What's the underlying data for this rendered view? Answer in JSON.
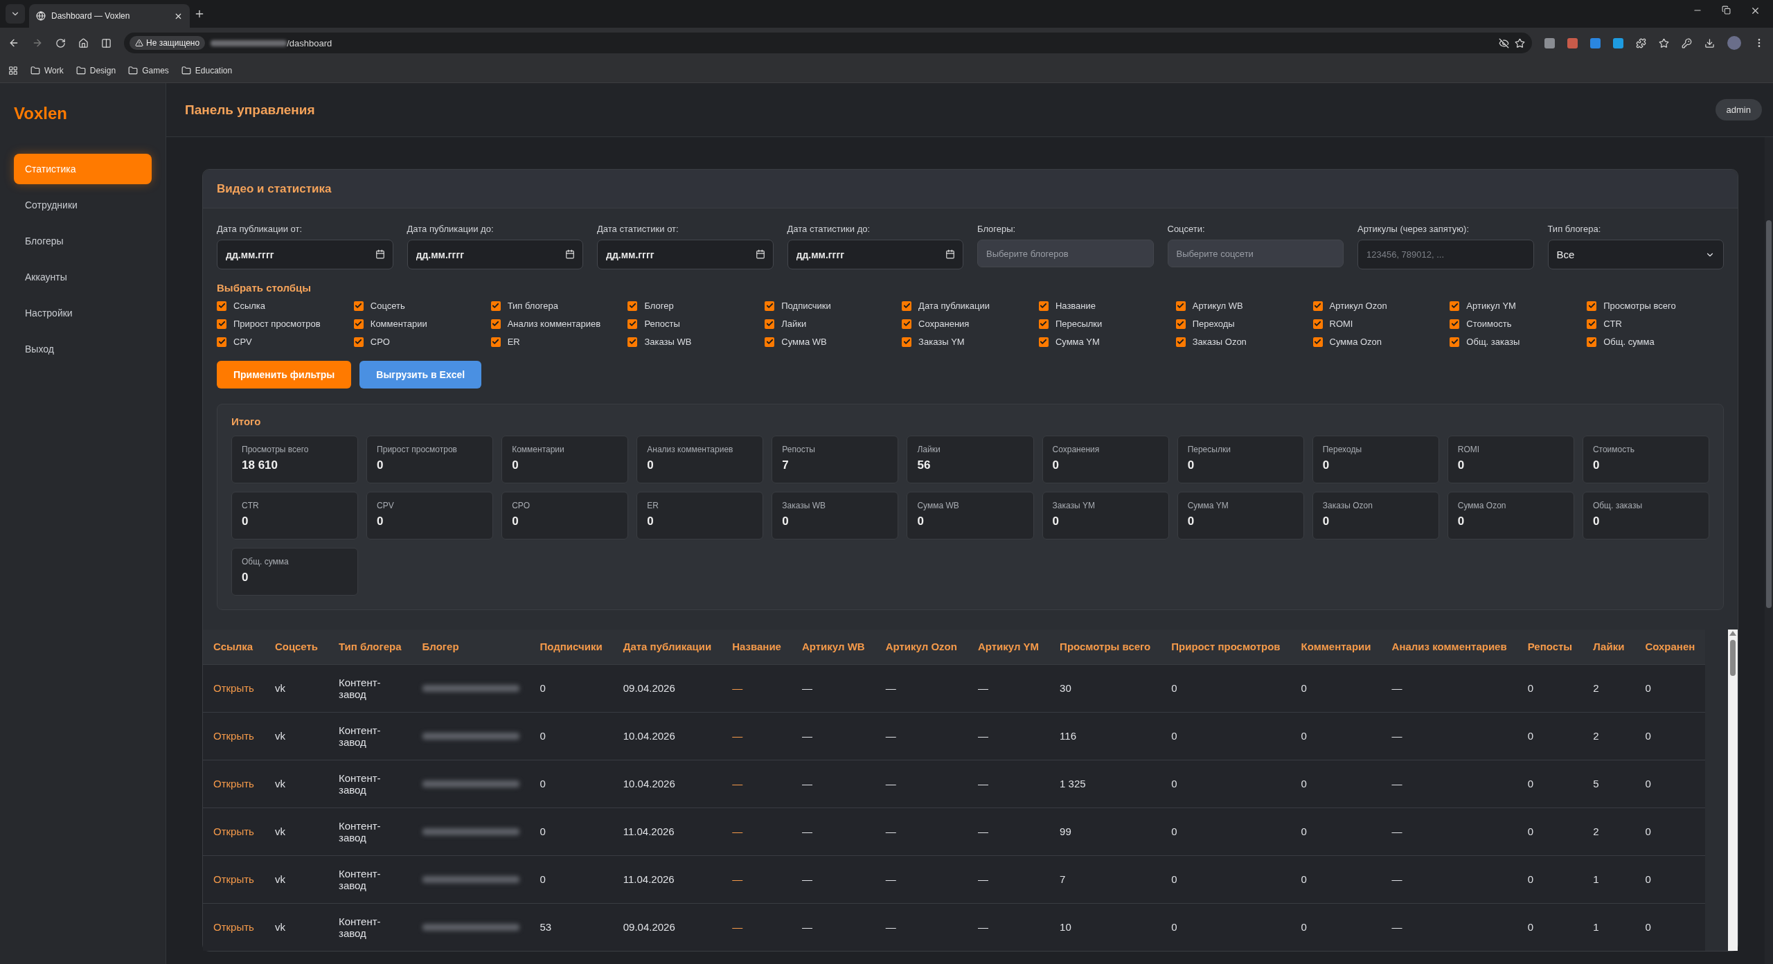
{
  "browser": {
    "tab_title": "Dashboard — Voxlen",
    "security_label": "Не защищено",
    "url_path": "/dashboard",
    "bookmarks": [
      "Work",
      "Design",
      "Games",
      "Education"
    ]
  },
  "sidebar": {
    "logo": "Voxlen",
    "items": [
      {
        "label": "Статистика",
        "selected": true
      },
      {
        "label": "Сотрудники",
        "selected": false
      },
      {
        "label": "Блогеры",
        "selected": false
      },
      {
        "label": "Аккаунты",
        "selected": false
      },
      {
        "label": "Настройки",
        "selected": false
      },
      {
        "label": "Выход",
        "selected": false
      }
    ]
  },
  "header": {
    "title": "Панель управления",
    "user": "admin"
  },
  "panel": {
    "title": "Видео и статистика",
    "filters": [
      {
        "label": "Дата публикации от:",
        "kind": "date",
        "placeholder": "дд.мм.гггг"
      },
      {
        "label": "Дата публикации до:",
        "kind": "date",
        "placeholder": "дд.мм.гггг"
      },
      {
        "label": "Дата статистики от:",
        "kind": "date",
        "placeholder": "дд.мм.гггг"
      },
      {
        "label": "Дата статистики до:",
        "kind": "date",
        "placeholder": "дд.мм.гггг"
      },
      {
        "label": "Блогеры:",
        "kind": "multi",
        "placeholder": "Выберите блогеров"
      },
      {
        "label": "Соцсети:",
        "kind": "multi",
        "placeholder": "Выберите соцсети"
      },
      {
        "label": "Артикулы (через запятую):",
        "kind": "text",
        "placeholder": "123456, 789012, ..."
      },
      {
        "label": "Тип блогера:",
        "kind": "select",
        "value": "Все"
      }
    ],
    "columns_title": "Выбрать столбцы",
    "columns": [
      {
        "label": "Ссылка",
        "checked": true
      },
      {
        "label": "Соцсеть",
        "checked": true
      },
      {
        "label": "Тип блогера",
        "checked": true
      },
      {
        "label": "Блогер",
        "checked": true
      },
      {
        "label": "Подписчики",
        "checked": true
      },
      {
        "label": "Дата публикации",
        "checked": true
      },
      {
        "label": "Название",
        "checked": true
      },
      {
        "label": "Артикул WB",
        "checked": true
      },
      {
        "label": "Артикул Ozon",
        "checked": true
      },
      {
        "label": "Артикул YM",
        "checked": true
      },
      {
        "label": "Просмотры всего",
        "checked": true
      },
      {
        "label": "Прирост просмотров",
        "checked": true
      },
      {
        "label": "Комментарии",
        "checked": true
      },
      {
        "label": "Анализ комментариев",
        "checked": true
      },
      {
        "label": "Репосты",
        "checked": true
      },
      {
        "label": "Лайки",
        "checked": true
      },
      {
        "label": "Сохранения",
        "checked": true
      },
      {
        "label": "Пересылки",
        "checked": true
      },
      {
        "label": "Переходы",
        "checked": true
      },
      {
        "label": "ROMI",
        "checked": true
      },
      {
        "label": "Стоимость",
        "checked": true
      },
      {
        "label": "CTR",
        "checked": true
      },
      {
        "label": "CPV",
        "checked": true
      },
      {
        "label": "CPO",
        "checked": true
      },
      {
        "label": "ER",
        "checked": true
      },
      {
        "label": "Заказы WB",
        "checked": true
      },
      {
        "label": "Сумма WB",
        "checked": true
      },
      {
        "label": "Заказы YM",
        "checked": true
      },
      {
        "label": "Сумма YM",
        "checked": true
      },
      {
        "label": "Заказы Ozon",
        "checked": true
      },
      {
        "label": "Сумма Ozon",
        "checked": true
      },
      {
        "label": "Общ. заказы",
        "checked": true
      },
      {
        "label": "Общ. сумма",
        "checked": true
      }
    ],
    "buttons": [
      {
        "label": "Применить фильтры",
        "kind": "primary"
      },
      {
        "label": "Выгрузить в Excel",
        "kind": "secondary"
      }
    ],
    "totals": {
      "title": "Итого",
      "items": [
        {
          "label": "Просмотры всего",
          "value": "18 610"
        },
        {
          "label": "Прирост просмотров",
          "value": "0"
        },
        {
          "label": "Комментарии",
          "value": "0"
        },
        {
          "label": "Анализ комментариев",
          "value": "0"
        },
        {
          "label": "Репосты",
          "value": "7"
        },
        {
          "label": "Лайки",
          "value": "56"
        },
        {
          "label": "Сохранения",
          "value": "0"
        },
        {
          "label": "Пересылки",
          "value": "0"
        },
        {
          "label": "Переходы",
          "value": "0"
        },
        {
          "label": "ROMI",
          "value": "0"
        },
        {
          "label": "Стоимость",
          "value": "0"
        },
        {
          "label": "CTR",
          "value": "0"
        },
        {
          "label": "CPV",
          "value": "0"
        },
        {
          "label": "CPO",
          "value": "0"
        },
        {
          "label": "ER",
          "value": "0"
        },
        {
          "label": "Заказы WB",
          "value": "0"
        },
        {
          "label": "Сумма WB",
          "value": "0"
        },
        {
          "label": "Заказы YM",
          "value": "0"
        },
        {
          "label": "Сумма YM",
          "value": "0"
        },
        {
          "label": "Заказы Ozon",
          "value": "0"
        },
        {
          "label": "Сумма Ozon",
          "value": "0"
        },
        {
          "label": "Общ. заказы",
          "value": "0"
        },
        {
          "label": "Общ. сумма",
          "value": "0"
        }
      ]
    }
  },
  "table": {
    "columns": [
      {
        "label": "Ссылка",
        "kind": "link"
      },
      {
        "label": "Соцсеть",
        "kind": "text"
      },
      {
        "label": "Тип блогера",
        "kind": "wrap"
      },
      {
        "label": "Блогер",
        "kind": "redacted"
      },
      {
        "label": "Подписчики",
        "kind": "text"
      },
      {
        "label": "Дата публикации",
        "kind": "text"
      },
      {
        "label": "Название",
        "kind": "accent"
      },
      {
        "label": "Артикул WB",
        "kind": "text"
      },
      {
        "label": "Артикул Ozon",
        "kind": "text"
      },
      {
        "label": "Артикул YM",
        "kind": "text"
      },
      {
        "label": "Просмотры всего",
        "kind": "text"
      },
      {
        "label": "Прирост просмотров",
        "kind": "text"
      },
      {
        "label": "Комментарии",
        "kind": "text"
      },
      {
        "label": "Анализ комментариев",
        "kind": "text"
      },
      {
        "label": "Репосты",
        "kind": "text"
      },
      {
        "label": "Лайки",
        "kind": "text"
      },
      {
        "label": "Сохранен",
        "kind": "text"
      }
    ],
    "rows": [
      {
        "cells": [
          "Открыть",
          "vk",
          "Контент-завод",
          "",
          "0",
          "09.04.2026",
          "—",
          "—",
          "—",
          "—",
          "30",
          "0",
          "0",
          "—",
          "0",
          "2",
          "0"
        ]
      },
      {
        "cells": [
          "Открыть",
          "vk",
          "Контент-завод",
          "",
          "0",
          "10.04.2026",
          "—",
          "—",
          "—",
          "—",
          "116",
          "0",
          "0",
          "—",
          "0",
          "2",
          "0"
        ]
      },
      {
        "cells": [
          "Открыть",
          "vk",
          "Контент-завод",
          "",
          "0",
          "10.04.2026",
          "—",
          "—",
          "—",
          "—",
          "1 325",
          "0",
          "0",
          "—",
          "0",
          "5",
          "0"
        ]
      },
      {
        "cells": [
          "Открыть",
          "vk",
          "Контент-завод",
          "",
          "0",
          "11.04.2026",
          "—",
          "—",
          "—",
          "—",
          "99",
          "0",
          "0",
          "—",
          "0",
          "2",
          "0"
        ]
      },
      {
        "cells": [
          "Открыть",
          "vk",
          "Контент-завод",
          "",
          "0",
          "11.04.2026",
          "—",
          "—",
          "—",
          "—",
          "7",
          "0",
          "0",
          "—",
          "0",
          "1",
          "0"
        ]
      },
      {
        "cells": [
          "Открыть",
          "vk",
          "Контент-завод",
          "",
          "53",
          "09.04.2026",
          "—",
          "—",
          "—",
          "—",
          "10",
          "0",
          "0",
          "—",
          "0",
          "1",
          "0"
        ]
      }
    ]
  }
}
